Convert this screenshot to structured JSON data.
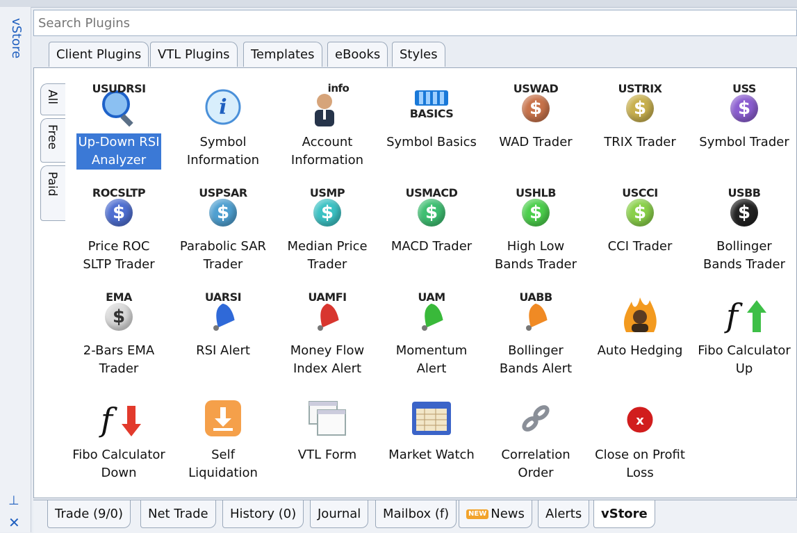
{
  "sidebar": {
    "title": "vStore",
    "pin_icon": "pin-icon",
    "close_icon": "close-icon"
  },
  "search": {
    "placeholder": "Search Plugins"
  },
  "top_tabs": [
    "Client Plugins",
    "VTL Plugins",
    "Templates",
    "eBooks",
    "Styles"
  ],
  "side_tabs": [
    "All",
    "Free",
    "Paid"
  ],
  "plugins": [
    {
      "label": "Up-Down RSI\nAnalyzer",
      "code": "USUDRSI",
      "icon": "magnifier-icon",
      "selected": true
    },
    {
      "label": "Symbol\nInformation",
      "code": "",
      "icon": "info-icon"
    },
    {
      "label": "Account\nInformation",
      "code": "info",
      "icon": "person-icon"
    },
    {
      "label": "Symbol Basics",
      "code": "BASICS",
      "icon": "blocks-icon"
    },
    {
      "label": "WAD Trader",
      "code": "USWAD",
      "icon": "dollar-coin-icon",
      "color": "#c8734b"
    },
    {
      "label": "TRIX Trader",
      "code": "USTRIX",
      "icon": "dollar-coin-icon",
      "color": "#c8b04f"
    },
    {
      "label": "Symbol Trader",
      "code": "USS",
      "icon": "dollar-coin-icon",
      "color": "#8b5ed0"
    },
    {
      "label": "Price ROC\nSLTP Trader",
      "code": "ROCSLTP",
      "icon": "dollar-coin-icon",
      "color": "#4f6fd1"
    },
    {
      "label": "Parabolic SAR\nTrader",
      "code": "USPSAR",
      "icon": "dollar-coin-icon",
      "color": "#4fa0d1"
    },
    {
      "label": "Median Price\nTrader",
      "code": "USMP",
      "icon": "dollar-coin-icon",
      "color": "#3cc2c4"
    },
    {
      "label": "MACD Trader",
      "code": "USMACD",
      "icon": "dollar-coin-icon",
      "color": "#3fbf72"
    },
    {
      "label": "High Low\nBands Trader",
      "code": "USHLB",
      "icon": "dollar-coin-icon",
      "color": "#4ccf4c"
    },
    {
      "label": "CCI Trader",
      "code": "USCCI",
      "icon": "dollar-coin-icon",
      "color": "#8ad04a"
    },
    {
      "label": "Bollinger\nBands Trader",
      "code": "USBB",
      "icon": "dollar-coin-icon",
      "color": "#222222"
    },
    {
      "label": "2-Bars EMA\nTrader",
      "code": "EMA",
      "icon": "dollar-coin-icon",
      "color": "#d9d9d9"
    },
    {
      "label": "RSI Alert",
      "code": "UARSI",
      "icon": "bell-icon",
      "color": "#2f69d8"
    },
    {
      "label": "Money Flow\nIndex Alert",
      "code": "UAMFI",
      "icon": "bell-icon",
      "color": "#d8362f"
    },
    {
      "label": "Momentum\nAlert",
      "code": "UAM",
      "icon": "bell-icon",
      "color": "#39b93a"
    },
    {
      "label": "Bollinger\nBands Alert",
      "code": "UABB",
      "icon": "bell-icon",
      "color": "#f08a24"
    },
    {
      "label": "Auto Hedging",
      "code": "",
      "icon": "fire-person-icon"
    },
    {
      "label": "Fibo Calculator\nUp",
      "code": "",
      "icon": "fibo-up-icon"
    },
    {
      "label": "Fibo Calculator\nDown",
      "code": "",
      "icon": "fibo-down-icon"
    },
    {
      "label": "Self\nLiquidation",
      "code": "",
      "icon": "download-icon"
    },
    {
      "label": "VTL Form",
      "code": "",
      "icon": "windows-icon"
    },
    {
      "label": "Market Watch",
      "code": "",
      "icon": "table-window-icon"
    },
    {
      "label": "Correlation\nOrder",
      "code": "",
      "icon": "chain-icon"
    },
    {
      "label": "Close on Profit\nLoss",
      "code": "",
      "icon": "close-circle-icon"
    }
  ],
  "bottom_tabs": [
    {
      "label": "Trade (9/0)"
    },
    {
      "label": "Net Trade"
    },
    {
      "label": "History (0)"
    },
    {
      "label": "Journal"
    },
    {
      "label": "Mailbox (f)"
    },
    {
      "label": "News",
      "badge": "NEW"
    },
    {
      "label": "Alerts"
    },
    {
      "label": "vStore",
      "active": true
    }
  ],
  "colors": {
    "accent": "#3b79d6",
    "selection": "#3b79d6"
  }
}
